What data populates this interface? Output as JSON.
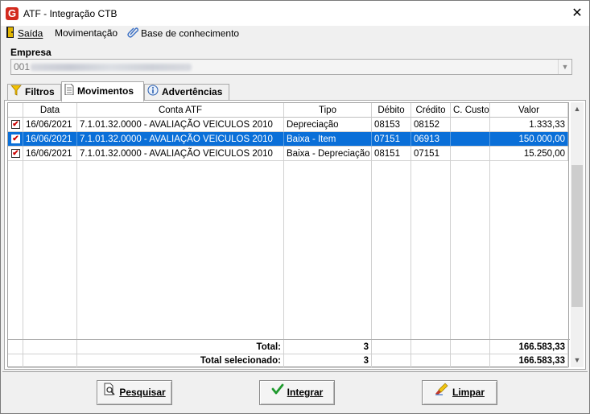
{
  "window": {
    "title": "ATF - Integração CTB",
    "app_icon_letter": "G"
  },
  "menu": {
    "items": [
      {
        "label": "Saída",
        "icon": "exit-door-icon"
      },
      {
        "label": "Movimentação",
        "icon": ""
      },
      {
        "label": "Base de conhecimento",
        "icon": "paperclip-icon"
      }
    ]
  },
  "empresa": {
    "label": "Empresa",
    "value": "001"
  },
  "tabs": [
    {
      "label": "Filtros",
      "icon": "filter-funnel-icon"
    },
    {
      "label": "Movimentos",
      "icon": "document-icon",
      "active": true
    },
    {
      "label": "Advertências",
      "icon": "info-icon"
    }
  ],
  "grid": {
    "columns": [
      "",
      "Data",
      "Conta ATF",
      "Tipo",
      "Débito",
      "Crédito",
      "C. Custo",
      "Valor"
    ],
    "rows": [
      {
        "checked": true,
        "data": "16/06/2021",
        "conta": "7.1.01.32.0000 - AVALIAÇÃO VEICULOS 2010",
        "tipo": "Depreciação",
        "debito": "08153",
        "credito": "08152",
        "ccusto": "",
        "valor": "1.333,33",
        "selected": false
      },
      {
        "checked": true,
        "data": "16/06/2021",
        "conta": "7.1.01.32.0000 - AVALIAÇÃO VEICULOS 2010",
        "tipo": "Baixa - Item",
        "debito": "07151",
        "credito": "06913",
        "ccusto": "",
        "valor": "150.000,00",
        "selected": true
      },
      {
        "checked": true,
        "data": "16/06/2021",
        "conta": "7.1.01.32.0000 - AVALIAÇÃO VEICULOS 2010",
        "tipo": "Baixa - Depreciação",
        "debito": "08151",
        "credito": "07151",
        "ccusto": "",
        "valor": "15.250,00",
        "selected": false
      }
    ],
    "totals": [
      {
        "label": "Total:",
        "count": "3",
        "valor": "166.583,33"
      },
      {
        "label": "Total selecionado:",
        "count": "3",
        "valor": "166.583,33"
      }
    ]
  },
  "buttons": {
    "pesquisar": "Pesquisar",
    "integrar": "Integrar",
    "limpar": "Limpar"
  },
  "colors": {
    "selection": "#0a6fd8",
    "check": "#cc0000",
    "accent_red": "#d32a1e"
  }
}
